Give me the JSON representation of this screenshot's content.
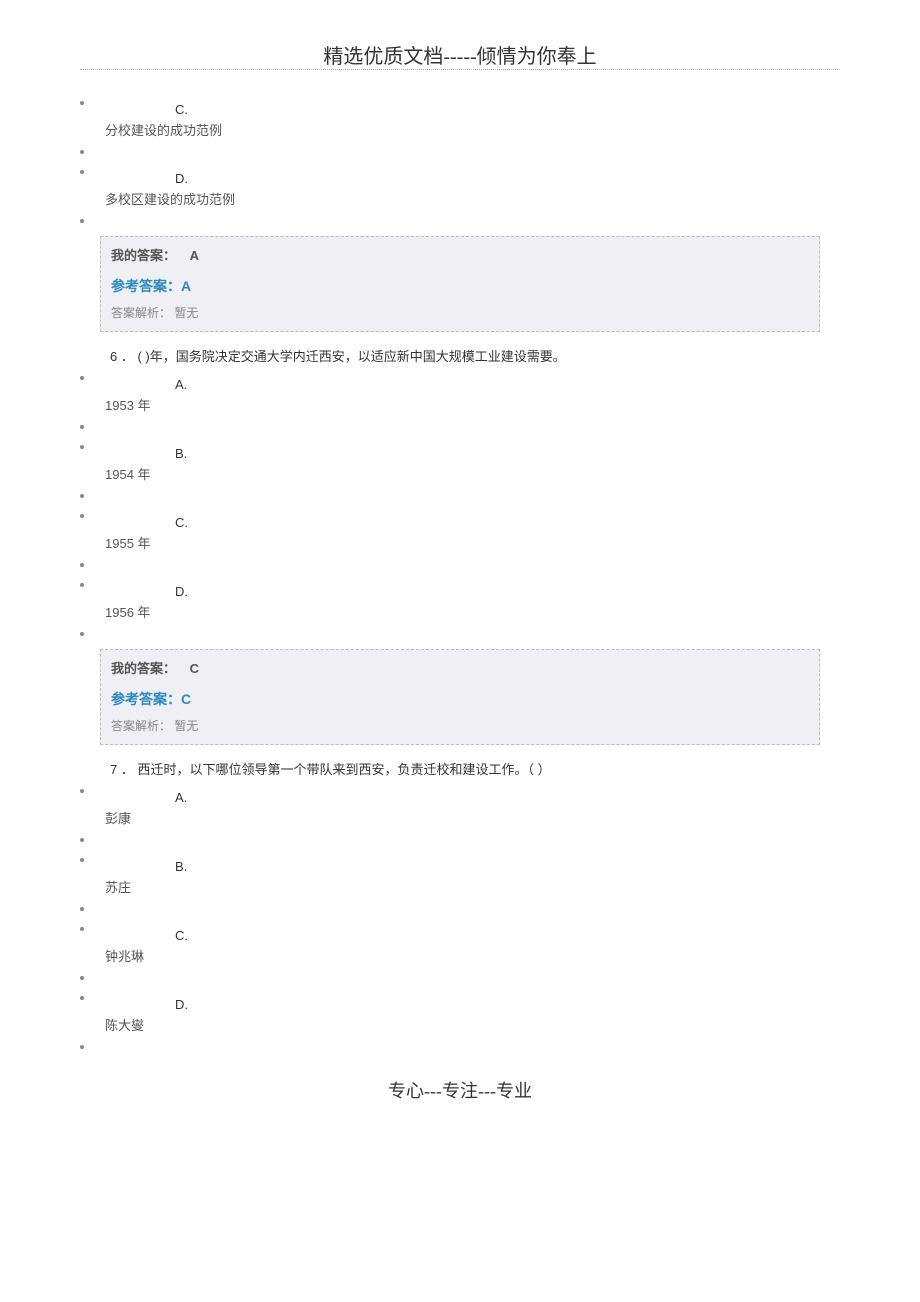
{
  "header": "精选优质文档-----倾情为你奉上",
  "footer": "专心---专注---专业",
  "block1": {
    "optC_letter": "C.",
    "optC_text": "分校建设的成功范例",
    "optD_letter": "D.",
    "optD_text": "多校区建设的成功范例",
    "myAnswerLabel": "我的答案：",
    "myAnswerValue": "A",
    "refAnswerLabel": "参考答案：",
    "refAnswerValue": "A",
    "analysisLabel": "答案解析：",
    "analysisValue": "暂无"
  },
  "q6": {
    "text": "6 ．  ( )年，国务院决定交通大学内迁西安，以适应新中国大规模工业建设需要。",
    "optA_letter": "A.",
    "optA_text": "1953 年",
    "optB_letter": "B.",
    "optB_text": "1954 年",
    "optC_letter": "C.",
    "optC_text": "1955 年",
    "optD_letter": "D.",
    "optD_text": "1956 年",
    "myAnswerLabel": "我的答案：",
    "myAnswerValue": "C",
    "refAnswerLabel": "参考答案：",
    "refAnswerValue": "C",
    "analysisLabel": "答案解析：",
    "analysisValue": "暂无"
  },
  "q7": {
    "text": "7 ．  西迁时，以下哪位领导第一个带队来到西安，负责迁校和建设工作。（ ）",
    "optA_letter": "A.",
    "optA_text": "彭康",
    "optB_letter": "B.",
    "optB_text": "苏庄",
    "optC_letter": "C.",
    "optC_text": "钟兆琳",
    "optD_letter": "D.",
    "optD_text": "陈大燮"
  }
}
